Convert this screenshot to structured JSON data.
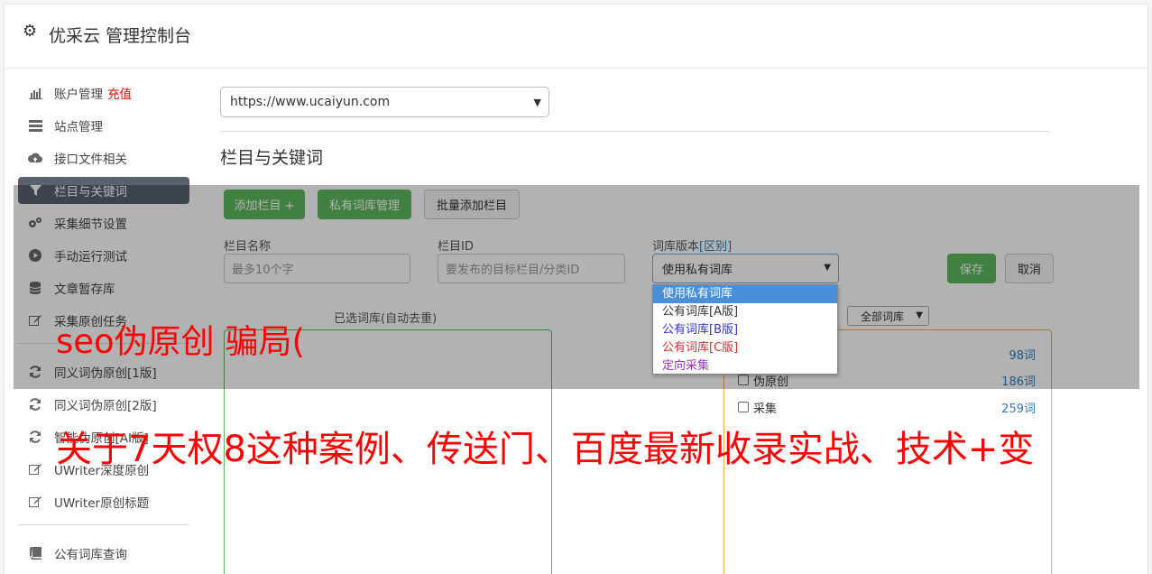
{
  "header": {
    "title": "优采云 管理控制台",
    "icon": "gear-icon"
  },
  "sidebar": {
    "items": [
      {
        "label": "账户管理",
        "badge": "充值",
        "icon": "bar-chart-icon"
      },
      {
        "label": "站点管理",
        "icon": "server-icon"
      },
      {
        "label": "接口文件相关",
        "icon": "cloud-upload-icon"
      },
      {
        "label": "栏目与关键词",
        "icon": "filter-icon",
        "active": true
      },
      {
        "label": "采集细节设置",
        "icon": "cogs-icon"
      },
      {
        "label": "手动运行测试",
        "icon": "play-circle-icon"
      },
      {
        "label": "文章暂存库",
        "icon": "database-icon"
      },
      {
        "label": "采集原创任务",
        "icon": "edit-icon"
      }
    ],
    "items2": [
      {
        "label": "同义词伪原创[1版]",
        "icon": "refresh-icon"
      },
      {
        "label": "同义词伪原创[2版]",
        "icon": "refresh-icon"
      },
      {
        "label": "智能伪原创[AI版]",
        "icon": "refresh-icon"
      },
      {
        "label": "UWriter深度原创",
        "icon": "edit-icon"
      },
      {
        "label": "UWriter原创标题",
        "icon": "edit-icon"
      }
    ],
    "items3": [
      {
        "label": "公有词库查询",
        "icon": "book-icon"
      }
    ]
  },
  "main": {
    "site_select": "https://www.ucaiyun.com",
    "section_title": "栏目与关键词",
    "buttons": {
      "add_column": "添加栏目 +",
      "private_lib": "私有词库管理",
      "batch_add": "批量添加栏目",
      "save": "保存",
      "cancel": "取消"
    },
    "fields": {
      "column_name_label": "栏目名称",
      "column_name_placeholder": "最多10个字",
      "column_id_label": "栏目ID",
      "column_id_placeholder": "要发布的目标栏目/分类ID",
      "lib_version_label": "词库版本",
      "lib_version_link": "[区别]",
      "lib_version_value": "使用私有词库"
    },
    "dropdown_options": [
      {
        "label": "使用私有词库",
        "color": "#ffffff",
        "selected": true
      },
      {
        "label": "公有词库[A版]",
        "color": "#333333"
      },
      {
        "label": "公有词库[B版]",
        "color": "#3333cc"
      },
      {
        "label": "公有词库[C版]",
        "color": "#cc3333"
      },
      {
        "label": "定向采集",
        "color": "#9933cc"
      }
    ],
    "selected_lib_label": "已选词库(自动去重)",
    "all_libs_select": "全部词库",
    "lib_list": [
      {
        "label": "",
        "count": "98词"
      },
      {
        "label": "伪原创",
        "count": "186词"
      },
      {
        "label": "采集",
        "count": "259词"
      }
    ]
  },
  "watermark": {
    "line1": "seo伪原创 骗局(",
    "line2": "关于7天权8这种案例、传送门、百度最新收录实战、技术+变"
  }
}
